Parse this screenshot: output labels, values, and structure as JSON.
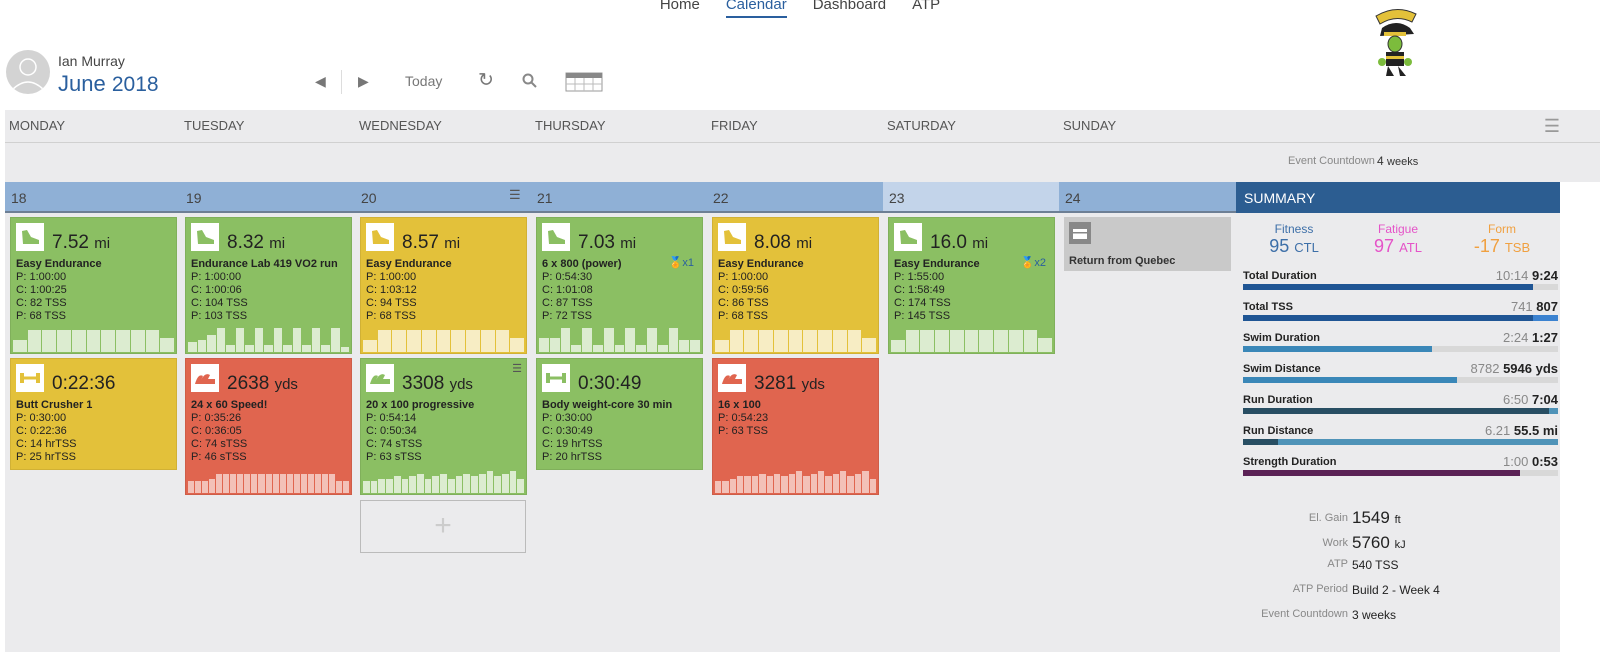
{
  "nav": {
    "items": [
      "Home",
      "Calendar",
      "Dashboard",
      "ATP"
    ],
    "active": 1
  },
  "header": {
    "user": "Ian Murray",
    "month": "June",
    "year": "2018",
    "today": "Today"
  },
  "logo": {
    "text": "The Evil Elf"
  },
  "weekdays": [
    "MONDAY",
    "TUESDAY",
    "WEDNESDAY",
    "THURSDAY",
    "FRIDAY",
    "SATURDAY",
    "SUNDAY"
  ],
  "event_countdown_top": {
    "label": "Event Countdown",
    "value": "4",
    "unit": "weeks"
  },
  "days": [
    "18",
    "19",
    "20",
    "21",
    "22",
    "23",
    "24"
  ],
  "colors": {
    "green": "#8bbf63",
    "yellow": "#e3c13a",
    "red": "#e0654f",
    "header_blue": "#2c5d91"
  },
  "workouts": [
    {
      "day": 0,
      "row": 0,
      "color": "green",
      "icon": "run-shoe-icon",
      "value": "7.52",
      "unit": "mi",
      "title": "Easy Endurance",
      "lines": [
        "P: 1:00:00",
        "C: 1:00:25",
        "C: 82 TSS",
        "P: 68 TSS"
      ],
      "profile": [
        5,
        9,
        9,
        9,
        9,
        9,
        9,
        9,
        9,
        9,
        6
      ]
    },
    {
      "day": 1,
      "row": 0,
      "color": "green",
      "icon": "run-shoe-icon",
      "value": "8.32",
      "unit": "mi",
      "title": "Endurance Lab 419 VO2 run",
      "lines": [
        "P: 1:00:00",
        "C: 1:00:06",
        "C: 104 TSS",
        "P: 103 TSS"
      ],
      "profile": [
        4,
        5,
        7,
        10,
        3,
        10,
        3,
        10,
        3,
        10,
        3,
        10,
        3,
        10,
        3,
        10,
        2
      ]
    },
    {
      "day": 2,
      "row": 0,
      "color": "yellow",
      "icon": "run-shoe-icon",
      "value": "8.57",
      "unit": "mi",
      "title": "Easy Endurance",
      "lines": [
        "P: 1:00:00",
        "C: 1:03:12",
        "C: 94 TSS",
        "P: 68 TSS"
      ],
      "profile": [
        5,
        9,
        9,
        9,
        9,
        9,
        9,
        9,
        9,
        9,
        6
      ]
    },
    {
      "day": 3,
      "row": 0,
      "color": "green",
      "icon": "run-shoe-icon",
      "value": "7.03",
      "unit": "mi",
      "title": "6 x 800 (power)",
      "medal": "x1",
      "lines": [
        "P: 0:54:30",
        "C: 1:01:08",
        "C: 87 TSS",
        "P: 72 TSS"
      ],
      "profile": [
        6,
        6,
        10,
        3,
        10,
        3,
        10,
        3,
        10,
        3,
        10,
        3,
        10,
        5,
        5
      ]
    },
    {
      "day": 4,
      "row": 0,
      "color": "yellow",
      "icon": "run-shoe-icon",
      "value": "8.08",
      "unit": "mi",
      "title": "Easy Endurance",
      "lines": [
        "P: 1:00:00",
        "C: 0:59:56",
        "C: 86 TSS",
        "P: 68 TSS"
      ],
      "profile": [
        5,
        9,
        9,
        9,
        9,
        9,
        9,
        9,
        9,
        9,
        6
      ]
    },
    {
      "day": 5,
      "row": 0,
      "color": "green",
      "icon": "run-shoe-icon",
      "value": "16.0",
      "unit": "mi",
      "title": "Easy Endurance",
      "medal": "x2",
      "lines": [
        "P: 1:55:00",
        "C: 1:58:49",
        "C: 174 TSS",
        "P: 145 TSS"
      ],
      "profile": [
        5,
        9,
        9,
        9,
        9,
        9,
        9,
        9,
        9,
        9,
        6
      ]
    },
    {
      "day": 0,
      "row": 1,
      "color": "yellow",
      "icon": "dumbbell-icon",
      "value": "0:22:36",
      "unit": "",
      "title": "Butt Crusher 1",
      "lines": [
        "P: 0:30:00",
        "C: 0:22:36",
        "C: 14 hrTSS",
        "P: 25 hrTSS"
      ],
      "profile": []
    },
    {
      "day": 1,
      "row": 1,
      "color": "red",
      "icon": "swim-wave-icon",
      "value": "2638",
      "unit": "yds",
      "title": "24 x 60 Speed!",
      "lines": [
        "P: 0:35:26",
        "C: 0:36:05",
        "C: 74 sTSS",
        "P: 46 sTSS"
      ],
      "profile": [
        5,
        5,
        5,
        6,
        8,
        8,
        8,
        8,
        8,
        8,
        8,
        8,
        8,
        8,
        8,
        8,
        8,
        8,
        8,
        8,
        8,
        5,
        5
      ]
    },
    {
      "day": 2,
      "row": 1,
      "color": "green",
      "icon": "swim-wave-icon",
      "value": "3308",
      "unit": "yds",
      "title": "20 x 100 progressive",
      "lines": [
        "P: 0:54:14",
        "C: 0:50:34",
        "C: 74 sTSS",
        "P: 63 sTSS"
      ],
      "profile": [
        5,
        5,
        6,
        6,
        7,
        6,
        7,
        8,
        6,
        7,
        8,
        6,
        7,
        8,
        7,
        8,
        9,
        7,
        8,
        9,
        6
      ]
    },
    {
      "day": 3,
      "row": 1,
      "color": "green",
      "icon": "dumbbell-icon",
      "value": "0:30:49",
      "unit": "",
      "title": "Body weight-core 30 min",
      "lines": [
        "P: 0:30:00",
        "C: 0:30:49",
        "C: 19 hrTSS",
        "P: 20 hrTSS"
      ],
      "profile": []
    },
    {
      "day": 4,
      "row": 1,
      "color": "red",
      "icon": "swim-wave-icon",
      "value": "3281",
      "unit": "yds",
      "title": "16 x 100",
      "lines": [
        "P: 0:54:23",
        "P: 63 TSS"
      ],
      "profile": [
        5,
        5,
        6,
        7,
        7,
        7,
        8,
        7,
        8,
        7,
        8,
        9,
        7,
        8,
        9,
        7,
        8,
        9,
        7,
        8,
        9,
        6
      ]
    }
  ],
  "event": {
    "day": 6,
    "title": "Return from Quebec",
    "icon": "suitcase-icon"
  },
  "summary": {
    "title": "SUMMARY",
    "fitness": {
      "label": "Fitness",
      "value": "95",
      "unit": "CTL",
      "color": "#3d6fa8"
    },
    "fatigue": {
      "label": "Fatigue",
      "value": "97",
      "unit": "ATL",
      "color": "#e553c8"
    },
    "form": {
      "label": "Form",
      "value": "-17",
      "unit": "TSB",
      "color": "#f0a040"
    },
    "rows": [
      {
        "label": "Total Duration",
        "planned": "10:14",
        "completed": "9:24",
        "fill": 0.92,
        "color": "#1f5594",
        "over": null
      },
      {
        "label": "Total TSS",
        "planned": "741",
        "completed": "807",
        "fill": 0.92,
        "color": "#1f5594",
        "over": "#3b82d0"
      },
      {
        "label": "Swim Duration",
        "planned": "2:24",
        "completed": "1:27",
        "fill": 0.6,
        "color": "#3a87b8",
        "over": null
      },
      {
        "label": "Swim Distance",
        "planned": "8782",
        "completed": "5946 yds",
        "fill": 0.68,
        "color": "#3a87b8",
        "over": null
      },
      {
        "label": "Run Duration",
        "planned": "6:50",
        "completed": "7:04",
        "fill": 0.97,
        "color": "#284e63",
        "over": "#4f93b8"
      },
      {
        "label": "Run Distance",
        "planned": "6.21",
        "completed": "55.5 mi",
        "fill": 0.11,
        "color": "#284e63",
        "over": "#4f93b8"
      },
      {
        "label": "Strength Duration",
        "planned": "1:00",
        "completed": "0:53",
        "fill": 0.88,
        "color": "#5a2155",
        "over": null
      }
    ],
    "stats": [
      {
        "label": "El. Gain",
        "value": "1549",
        "unit": "ft",
        "big": true
      },
      {
        "label": "Work",
        "value": "5760",
        "unit": "kJ",
        "big": true
      },
      {
        "label": "ATP",
        "value": "540 TSS",
        "unit": "",
        "big": false
      },
      {
        "label": "ATP Period",
        "value": "Build 2 - Week 4",
        "unit": "",
        "big": false
      },
      {
        "label": "Event Countdown",
        "value": "3 weeks",
        "unit": "",
        "big": false
      }
    ]
  }
}
